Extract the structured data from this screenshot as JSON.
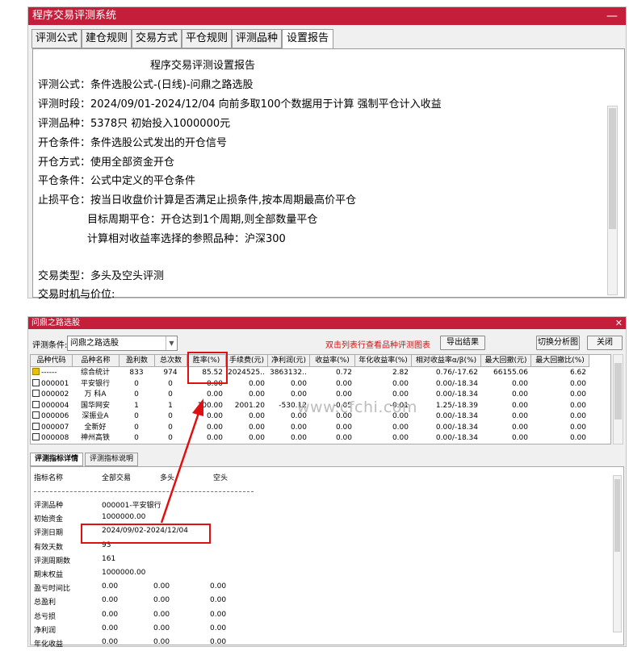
{
  "top_window": {
    "title": "程序交易评测系统",
    "minimize": "—",
    "tabs": [
      "评测公式",
      "建仓规则",
      "交易方式",
      "平仓规则",
      "评测品种",
      "设置报告"
    ],
    "active_tab": "设置报告",
    "report": {
      "heading": "程序交易评测设置报告",
      "lines": [
        "评测公式：条件选股公式-(日线)-问鼎之路选股",
        "评测时段：2024/09/01-2024/12/04 向前多取100个数据用于计算 强制平仓计入收益",
        "评测品种：5378只 初始投入1000000元",
        "开仓条件：条件选股公式发出的开仓信号",
        "开仓方式：使用全部资金开仓",
        "平仓条件：公式中定义的平仓条件",
        "止损平仓：按当日收盘价计算是否满足止损条件,按本周期最高价平仓",
        "目标周期平仓：开仓达到1个周期,则全部数量平仓",
        "计算相对收益率选择的参照品种：沪深300",
        "交易类型：多头及空头评测",
        "交易时机与价位:"
      ]
    }
  },
  "bottom_window": {
    "title": "问鼎之路选股",
    "close": "✕",
    "condition_label": "评测条件:",
    "condition_value": "问鼎之路选股",
    "hint": "双击列表行查看品种评测图表",
    "export_btn": "导出结果",
    "switch_btn": "切换分析图",
    "close_btn": "关闭",
    "hint_color": "#d01010",
    "columns": [
      "品种代码",
      "品种名称",
      "盈利数",
      "总次数",
      "胜率(%)",
      "手续费(元)",
      "净利润(元)",
      "收益率(%)",
      "年化收益率(%)",
      "相对收益率α/β(%)",
      "最大回撤(元)",
      "最大回撤比(%)"
    ],
    "rows": [
      [
        "------",
        "综合统计",
        "833",
        "974",
        "85.52",
        "2024525....",
        "3863132...",
        "0.72",
        "2.82",
        "0.76/-17.62",
        "66155.06",
        "6.62"
      ],
      [
        "000001",
        "平安银行",
        "0",
        "0",
        "0.00",
        "0.00",
        "0.00",
        "0.00",
        "0.00",
        "0.00/-18.34",
        "0.00",
        "0.00"
      ],
      [
        "000002",
        "万 科A",
        "0",
        "0",
        "0.00",
        "0.00",
        "0.00",
        "0.00",
        "0.00",
        "0.00/-18.34",
        "0.00",
        "0.00"
      ],
      [
        "000004",
        "国华网安",
        "1",
        "1",
        "100.00",
        "2001.20",
        "-530.12",
        "-0.05",
        "-0.01",
        "1.25/-18.39",
        "0.00",
        "0.00"
      ],
      [
        "000006",
        "深振业A",
        "0",
        "0",
        "0.00",
        "0.00",
        "0.00",
        "0.00",
        "0.00",
        "0.00/-18.34",
        "0.00",
        "0.00"
      ],
      [
        "000007",
        "全新好",
        "0",
        "0",
        "0.00",
        "0.00",
        "0.00",
        "0.00",
        "0.00",
        "0.00/-18.34",
        "0.00",
        "0.00"
      ],
      [
        "000008",
        "神州高铁",
        "0",
        "0",
        "0.00",
        "0.00",
        "0.00",
        "0.00",
        "0.00",
        "0.00/-18.34",
        "0.00",
        "0.00"
      ]
    ],
    "detail_tabs": [
      "评测指标详情",
      "评测指标说明"
    ],
    "detail_headers": [
      "指标名称",
      "全部交易",
      "多头",
      "空头"
    ],
    "detail_rows": [
      [
        "评测品种",
        "000001-平安银行",
        "",
        ""
      ],
      [
        "初始资金",
        "1000000.00",
        "",
        ""
      ],
      [
        "评测日期",
        "2024/09/02-2024/12/04",
        "",
        ""
      ],
      [
        "有效天数",
        "93",
        "",
        ""
      ],
      [
        "评测周期数",
        "161",
        "",
        ""
      ],
      [
        "期末权益",
        "1000000.00",
        "",
        ""
      ],
      [
        "盈亏时间比",
        "0.00",
        "0.00",
        "0.00"
      ],
      [
        "总盈利",
        "0.00",
        "0.00",
        "0.00"
      ],
      [
        "总亏损",
        "0.00",
        "0.00",
        "0.00"
      ],
      [
        "净利润",
        "0.00",
        "0.00",
        "0.00"
      ],
      [
        "年化收益",
        "0.00",
        "0.00",
        "0.00"
      ]
    ]
  },
  "watermark": "www.cfchi.com",
  "annotation_color": "#e01010"
}
